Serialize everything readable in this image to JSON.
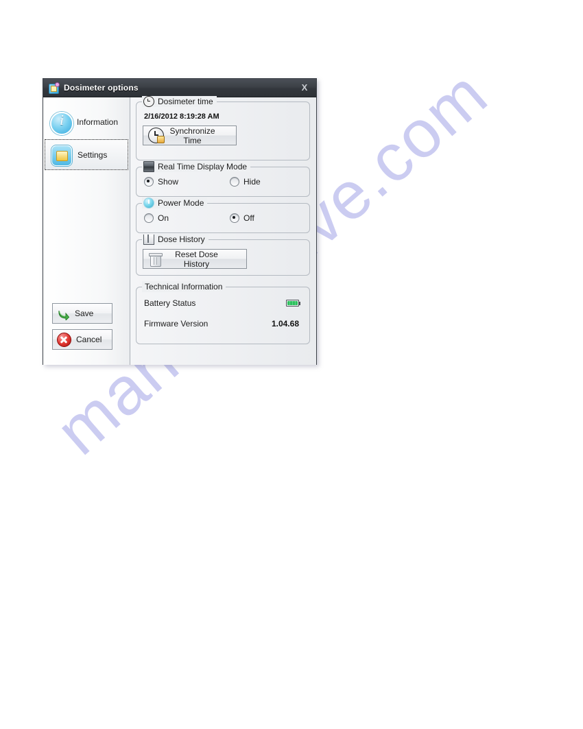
{
  "page": {
    "watermark": "manualshive.com",
    "background": "#ffffff"
  },
  "dialog": {
    "title": "Dosimeter options",
    "title_icon": "dosimeter-app-icon",
    "close_label": "X",
    "colors": {
      "titlebar": "#3c4046",
      "body": "#eef0f2",
      "accent_blue": "#37a9dd",
      "save_green": "#3da63d",
      "cancel_red": "#e23a34",
      "battery_green": "#2fbf5e"
    }
  },
  "sidebar": {
    "items": [
      {
        "label": "Information",
        "icon": "info-icon",
        "selected": false
      },
      {
        "label": "Settings",
        "icon": "settings-icon",
        "selected": true
      }
    ],
    "buttons": {
      "save": {
        "label": "Save",
        "icon": "green-arrow-icon"
      },
      "cancel": {
        "label": "Cancel",
        "icon": "red-x-icon"
      }
    }
  },
  "groups": {
    "dosimeter_time": {
      "legend": "Dosimeter time",
      "legend_icon": "clock-icon",
      "value": "2/16/2012 8:19:28 AM",
      "button": {
        "label": "Synchronize Time",
        "icon": "sync-clock-icon"
      }
    },
    "real_time_display": {
      "legend": "Real Time Display Mode",
      "legend_icon": "display-icon",
      "options": [
        {
          "label": "Show",
          "checked": true
        },
        {
          "label": "Hide",
          "checked": false
        }
      ]
    },
    "power_mode": {
      "legend": "Power Mode",
      "legend_icon": "power-icon",
      "options": [
        {
          "label": "On",
          "checked": false
        },
        {
          "label": "Off",
          "checked": true
        }
      ]
    },
    "dose_history": {
      "legend": "Dose History",
      "legend_icon": "book-icon",
      "button": {
        "label": "Reset Dose History",
        "icon": "trash-icon"
      }
    },
    "technical_information": {
      "legend": "Technical Information",
      "rows": [
        {
          "label": "Battery Status",
          "value": "",
          "icon": "battery-full-icon",
          "battery_percent": 100
        },
        {
          "label": "Firmware Version",
          "value": "1.04.68",
          "icon": ""
        }
      ]
    }
  }
}
